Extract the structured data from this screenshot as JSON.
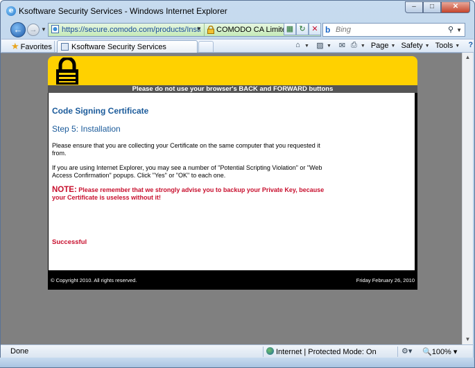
{
  "window": {
    "title": "Ksoftware Security Services - Windows Internet Explorer",
    "min_glyph": "–",
    "max_glyph": "□",
    "close_glyph": "✕"
  },
  "address": {
    "url": "https://secure.comodo.com/products/InstallCodeSi",
    "cert_label": "COMODO CA Limited [GB]",
    "search_placeholder": "Bing",
    "bing_glyph": "b"
  },
  "command_bar": {
    "favorites_label": "Favorites",
    "tab_label": "Ksoftware Security Services",
    "page_label": "Page",
    "safety_label": "Safety",
    "tools_label": "Tools"
  },
  "page": {
    "nav_warning": "Please do not use your browser's BACK and FORWARD buttons",
    "title": "Code Signing Certificate",
    "step": "Step 5: Installation",
    "para1": "Please ensure that you are collecting your Certificate on the same computer that you requested it from.",
    "para2": "If you are using Internet Explorer, you may see a number of \"Potential Scripting Violation\" or \"Web Access Confirmation\" popups. Click \"Yes\" or \"OK\" to each one.",
    "note_label": "NOTE:",
    "note_text": " Please remember that we strongly advise you to backup your Private Key, because your Certificate is useless without it!",
    "success": "Successful",
    "footer_copyright": "© Copyright 2010. All rights reserved.",
    "footer_date": "Friday February 26, 2010"
  },
  "status": {
    "text": "Done",
    "zone": "Internet | Protected Mode: On",
    "zoom": "100%"
  },
  "colors": {
    "header_yellow": "#ffd100",
    "heading_blue": "#1a5a9a",
    "alert_red": "#c8102e",
    "secure_green": "#c5eab8"
  }
}
